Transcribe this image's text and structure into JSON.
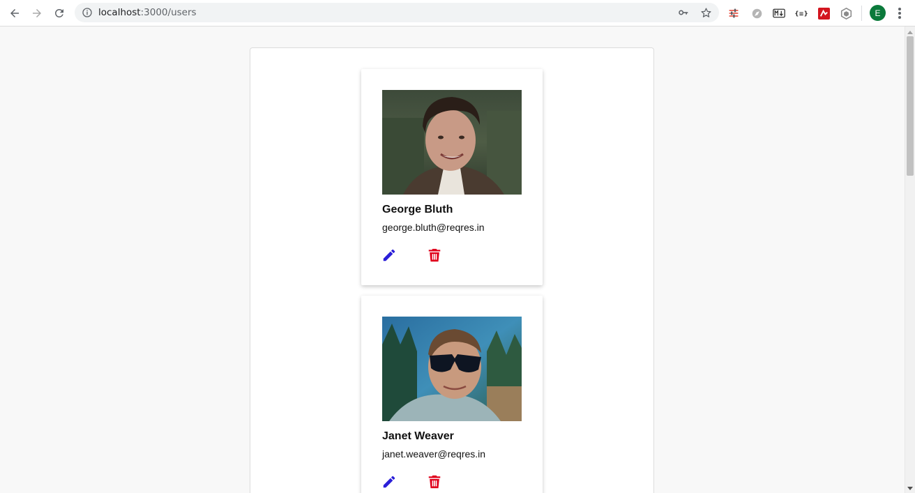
{
  "browser": {
    "url_host": "localhost",
    "url_path": ":3000/users",
    "profile_initial": "E"
  },
  "icons": {
    "back": "arrow-left-icon",
    "forward": "arrow-right-icon",
    "reload": "reload-icon",
    "info": "info-icon",
    "key": "key-icon",
    "star": "star-icon",
    "edit": "pencil-icon",
    "delete": "trash-icon"
  },
  "colors": {
    "edit_icon": "#2b1fd8",
    "delete_icon": "#e0001b",
    "avatar_bg": "#0b7a3b"
  },
  "users": [
    {
      "name": "George Bluth",
      "email": "george.bluth@reqres.in"
    },
    {
      "name": "Janet Weaver",
      "email": "janet.weaver@reqres.in"
    }
  ]
}
